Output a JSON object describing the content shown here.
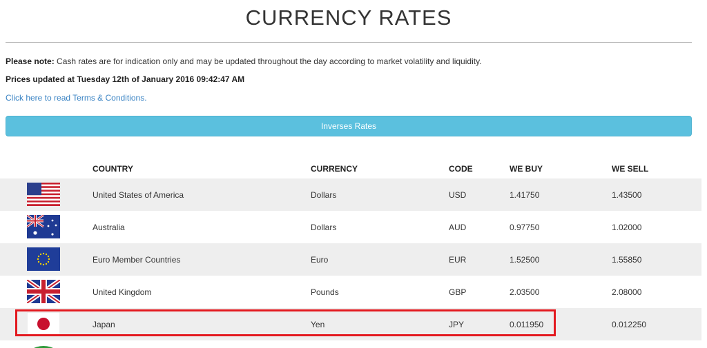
{
  "page": {
    "title": "CURRENCY RATES",
    "note_label": "Please note:",
    "note_text": " Cash rates are for indication only and may be updated throughout the day according to market volatility and liquidity.",
    "updated_text": "Prices updated at Tuesday 12th of January 2016 09:42:47 AM",
    "terms_link": "Click here to read Terms & Conditions.",
    "inverse_button": "Inverses Rates"
  },
  "table": {
    "headers": {
      "country": "COUNTRY",
      "currency": "CURRENCY",
      "code": "CODE",
      "buy": "WE BUY",
      "sell": "WE SELL"
    },
    "rows": [
      {
        "flag": "usa-flag-icon",
        "country": "United States of America",
        "currency": "Dollars",
        "code": "USD",
        "buy": "1.41750",
        "sell": "1.43500"
      },
      {
        "flag": "australia-flag-icon",
        "country": "Australia",
        "currency": "Dollars",
        "code": "AUD",
        "buy": "0.97750",
        "sell": "1.02000"
      },
      {
        "flag": "eu-flag-icon",
        "country": "Euro Member Countries",
        "currency": "Euro",
        "code": "EUR",
        "buy": "1.52500",
        "sell": "1.55850"
      },
      {
        "flag": "uk-flag-icon",
        "country": "United Kingdom",
        "currency": "Pounds",
        "code": "GBP",
        "buy": "2.03500",
        "sell": "2.08000"
      },
      {
        "flag": "japan-flag-icon",
        "country": "Japan",
        "currency": "Yen",
        "code": "JPY",
        "buy": "0.011950",
        "sell": "0.012250"
      }
    ]
  },
  "colors": {
    "button": "#5bc0de",
    "link": "#3b84c4",
    "highlight": "#e3191f",
    "row_alt": "#eeeeee"
  }
}
